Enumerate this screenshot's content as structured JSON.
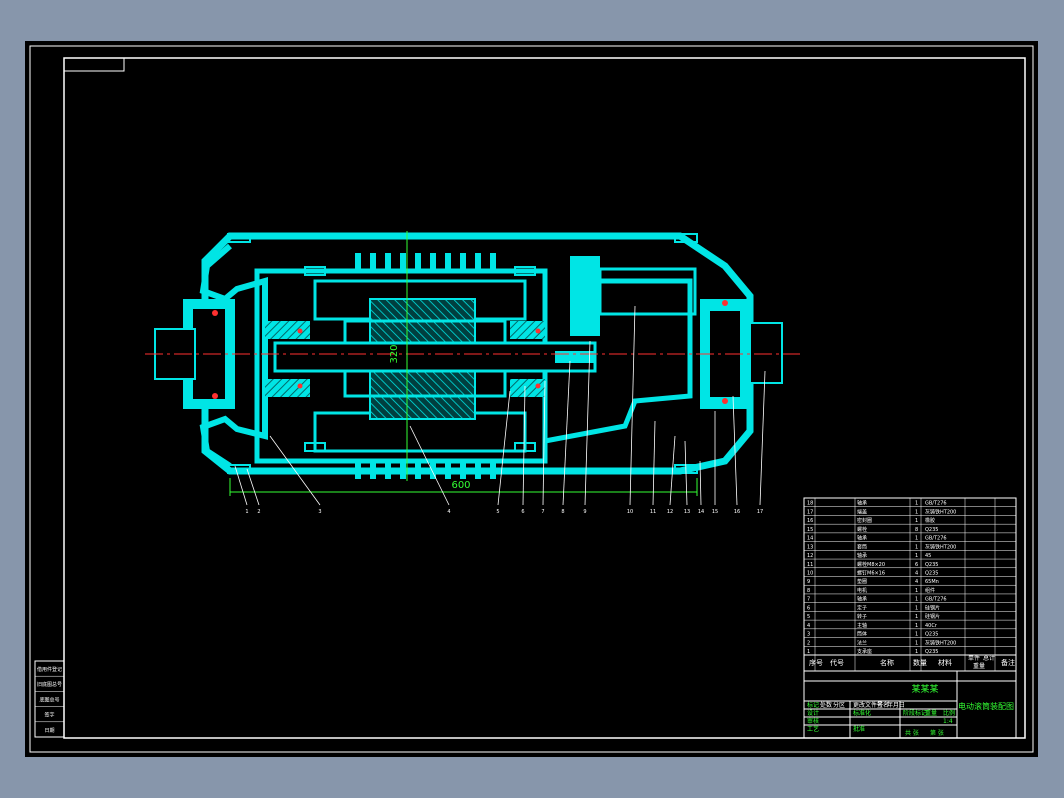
{
  "colors": {
    "background": "#8796ab",
    "sheet": "#000000",
    "frame": "#ffffff",
    "part": "#00e5e5",
    "hatch": "#00e5e5",
    "centerline": "#ff3030",
    "dimension": "#33ff33",
    "leader": "#ffffff"
  },
  "drawing": {
    "dim_overall_length": "600",
    "dim_diameter": "320",
    "balloons": [
      "1",
      "2",
      "3",
      "4",
      "5",
      "6",
      "7",
      "8",
      "9",
      "10",
      "11",
      "12",
      "13",
      "14",
      "15",
      "16",
      "17"
    ]
  },
  "parts_list": {
    "rows": [
      {
        "no": "18",
        "name": "轴承",
        "qty": "1",
        "note": "GB/T276"
      },
      {
        "no": "17",
        "name": "端盖",
        "qty": "1",
        "note": "灰铸铁HT200"
      },
      {
        "no": "16",
        "name": "密封圈",
        "qty": "1",
        "note": "橡胶"
      },
      {
        "no": "15",
        "name": "螺栓",
        "qty": "8",
        "note": "Q235"
      },
      {
        "no": "14",
        "name": "轴承",
        "qty": "1",
        "note": "GB/T276"
      },
      {
        "no": "13",
        "name": "套筒",
        "qty": "1",
        "note": "灰铸铁HT200"
      },
      {
        "no": "12",
        "name": "轴承",
        "qty": "1",
        "note": "45"
      },
      {
        "no": "11",
        "name": "螺栓M8×20",
        "qty": "6",
        "note": "Q235"
      },
      {
        "no": "10",
        "name": "螺钉M6×16",
        "qty": "4",
        "note": "Q235"
      },
      {
        "no": "9",
        "name": "垫圈",
        "qty": "4",
        "note": "65Mn"
      },
      {
        "no": "8",
        "name": "电机",
        "qty": "1",
        "note": "组件"
      },
      {
        "no": "7",
        "name": "轴承",
        "qty": "1",
        "note": "GB/T276"
      },
      {
        "no": "6",
        "name": "定子",
        "qty": "1",
        "note": "硅钢片"
      },
      {
        "no": "5",
        "name": "转子",
        "qty": "1",
        "note": "硅钢片"
      },
      {
        "no": "4",
        "name": "主轴",
        "qty": "1",
        "note": "40Cr"
      },
      {
        "no": "3",
        "name": "筒体",
        "qty": "1",
        "note": "Q235"
      },
      {
        "no": "2",
        "name": "法兰",
        "qty": "1",
        "note": "灰铸铁HT200"
      },
      {
        "no": "1",
        "name": "支承座",
        "qty": "1",
        "note": "Q235"
      }
    ],
    "header": {
      "no": "序号",
      "code": "代号",
      "name": "名称",
      "qty": "数量",
      "material": "材料",
      "unit_weight": "单件",
      "total_weight": "总计",
      "weight": "重量",
      "remark": "备注"
    }
  },
  "title_block": {
    "company": "某某某",
    "drawing_title": "电动滚筒装配图",
    "labels": {
      "mark": "标记",
      "count": "处数",
      "zone": "分区",
      "change_doc": "更改文件号",
      "sign": "签名",
      "date": "年月日",
      "design": "设计",
      "standardize": "标准化",
      "stage_mark": "阶段标记",
      "weight": "重量",
      "scale": "比例",
      "review": "审核",
      "process": "工艺",
      "approve": "批准",
      "sheet_total": "共 张",
      "sheet_no": "第 张"
    },
    "scale_value": "1:4"
  },
  "side_block": {
    "rows": [
      "借用件登记",
      "旧底图总号",
      "底图总号",
      "签字",
      "日期"
    ]
  }
}
